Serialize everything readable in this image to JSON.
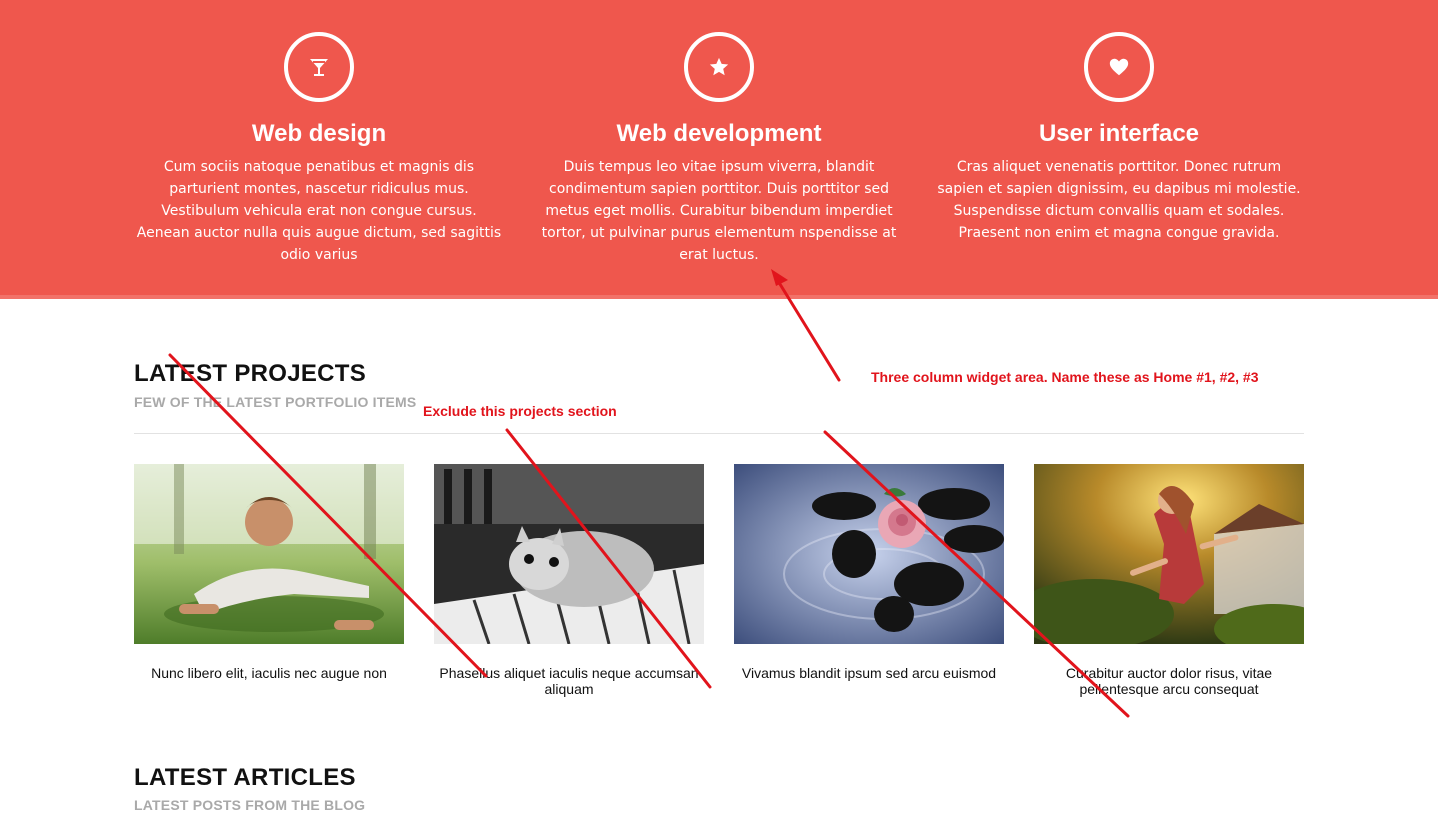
{
  "hero": {
    "columns": [
      {
        "icon": "cocktail-icon",
        "title": "Web design",
        "text": "Cum sociis natoque penatibus et magnis dis parturient montes, nascetur ridiculus mus. Vestibulum vehicula erat non congue cursus. Aenean auctor nulla quis augue dictum, sed sagittis odio varius"
      },
      {
        "icon": "star-icon",
        "title": "Web development",
        "text": "Duis tempus leo vitae ipsum viverra, blandit condimentum sapien porttitor. Duis porttitor sed metus eget mollis. Curabitur bibendum imperdiet tortor, ut pulvinar purus elementum nspendisse at erat luctus."
      },
      {
        "icon": "heart-icon",
        "title": "User interface",
        "text": "Cras aliquet venenatis porttitor. Donec rutrum sapien et sapien dignissim, eu dapibus mi molestie. Suspendisse dictum convallis quam et sodales. Praesent non enim et magna congue gravida."
      }
    ],
    "accent": "#ef574d"
  },
  "projects": {
    "title": "LATEST PROJECTS",
    "subtitle": "FEW OF THE LATEST PORTFOLIO ITEMS",
    "items": [
      {
        "image": "man-doing-pushups",
        "caption": "Nunc libero elit, iaculis nec augue non"
      },
      {
        "image": "kitten-on-piano",
        "caption": "Phasellus aliquet iaculis neque accumsan aliquam"
      },
      {
        "image": "rose-on-stones",
        "caption": "Vivamus blandit ipsum sed arcu euismod"
      },
      {
        "image": "woman-in-sunlight",
        "caption": "Curabitur auctor dolor risus, vitae pellentesque arcu consequat"
      }
    ]
  },
  "articles": {
    "title": "LATEST ARTICLES",
    "subtitle": "LATEST POSTS FROM THE BLOG"
  },
  "annotations": {
    "widget_note": "Three column widget area. Name these as Home #1, #2, #3",
    "exclude_note": "Exclude this projects section",
    "color": "#e1141c"
  }
}
